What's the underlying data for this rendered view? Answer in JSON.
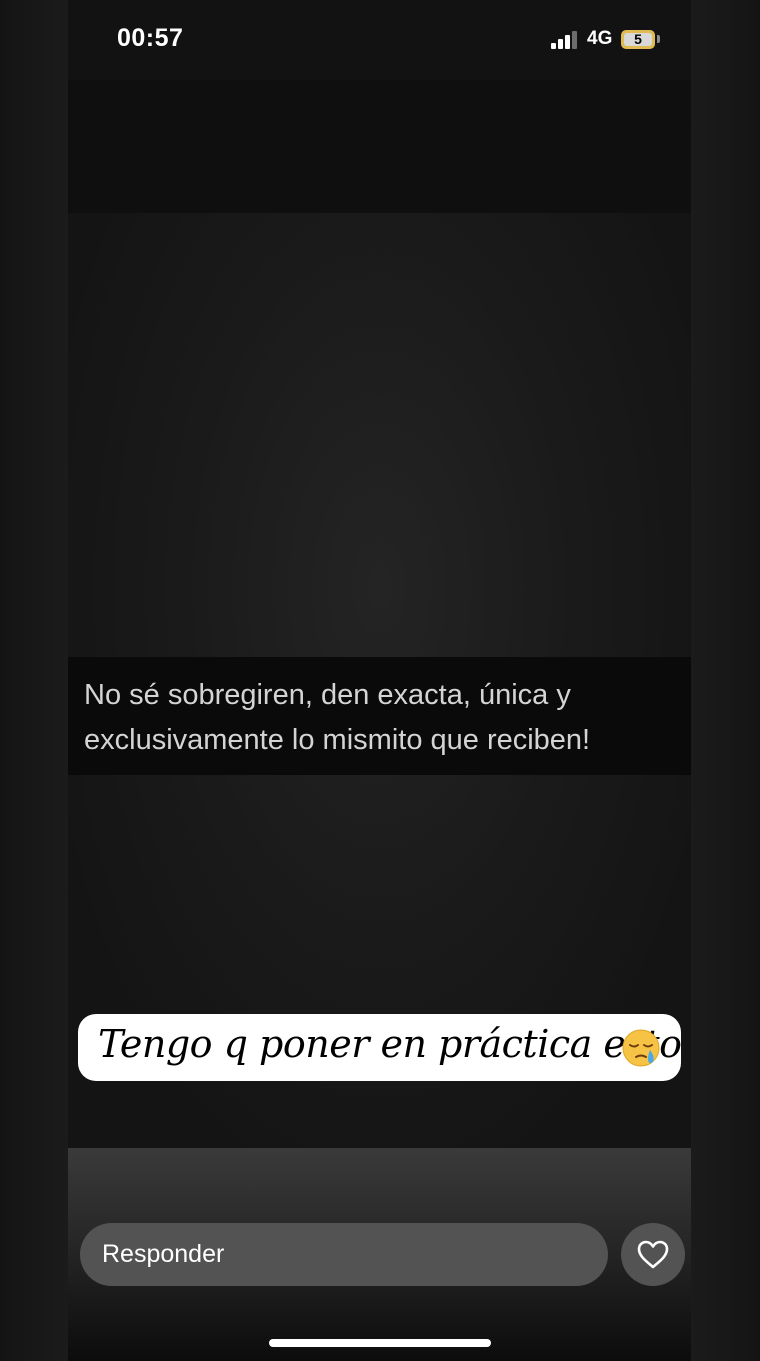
{
  "status_bar": {
    "time": "00:57",
    "network": "4G",
    "battery_level": "5",
    "battery_color": "#e0bb54"
  },
  "story": {
    "quote": "No sé sobregiren, den exacta, única y exclusivamente lo mismito que reciben!",
    "sticker_text": "Tengo q poner en práctica esto",
    "sticker_emoji": "sleepy-face-emoji"
  },
  "reply_bar": {
    "placeholder": "Responder",
    "like_icon": "heart-icon"
  }
}
